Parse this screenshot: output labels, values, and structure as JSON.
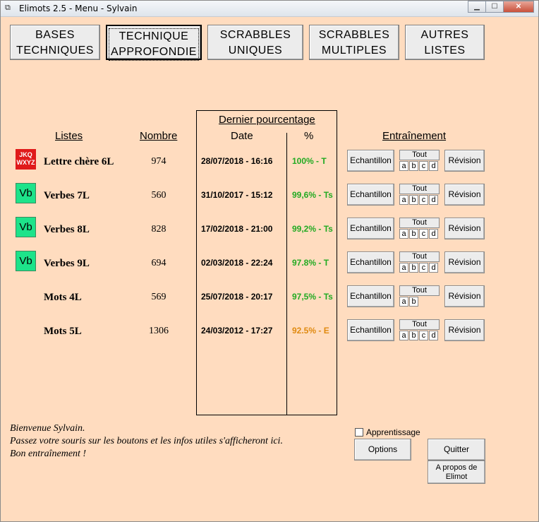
{
  "window": {
    "title": "Elimots 2.5 - Menu - Sylvain",
    "min": "▁",
    "max": "☐",
    "close": "✕"
  },
  "nav": [
    {
      "line1": "BASES",
      "line2": "TECHNIQUES"
    },
    {
      "line1": "TECHNIQUE",
      "line2": "APPROFONDIE"
    },
    {
      "line1": "SCRABBLES",
      "line2": "UNIQUES"
    },
    {
      "line1": "SCRABBLES",
      "line2": "MULTIPLES"
    },
    {
      "line1": "AUTRES",
      "line2": "LISTES"
    }
  ],
  "headers": {
    "listes": "Listes",
    "nombre": "Nombre",
    "dernier": "Dernier pourcentage",
    "date": "Date",
    "pct": "%",
    "entrainement": "Entraînement"
  },
  "rows": [
    {
      "icon": "JKQ\nWXYZ",
      "icon_type": "jkq",
      "name": "Lettre chère 6L",
      "count": "974",
      "date": "28/07/2018 - 16:16",
      "pct": "100% - T",
      "pct_color": "#22aa22",
      "letters": [
        "a",
        "b",
        "c",
        "d"
      ]
    },
    {
      "icon": "Vb",
      "icon_type": "vb",
      "name": "Verbes 7L",
      "count": "560",
      "date": "31/10/2017 - 15:12",
      "pct": "99,6% - Ts",
      "pct_color": "#22aa22",
      "letters": [
        "a",
        "b",
        "c",
        "d"
      ]
    },
    {
      "icon": "Vb",
      "icon_type": "vb",
      "name": "Verbes 8L",
      "count": "828",
      "date": "17/02/2018 - 21:00",
      "pct": "99,2% - Ts",
      "pct_color": "#22aa22",
      "letters": [
        "a",
        "b",
        "c",
        "d"
      ]
    },
    {
      "icon": "Vb",
      "icon_type": "vb",
      "name": "Verbes 9L",
      "count": "694",
      "date": "02/03/2018 - 22:24",
      "pct": "97.8% - T",
      "pct_color": "#22aa22",
      "letters": [
        "a",
        "b",
        "c",
        "d"
      ]
    },
    {
      "icon": "",
      "icon_type": "none",
      "name": "Mots 4L",
      "count": "569",
      "date": "25/07/2018 - 20:17",
      "pct": "97,5% - Ts",
      "pct_color": "#22aa22",
      "letters": [
        "a",
        "b"
      ]
    },
    {
      "icon": "",
      "icon_type": "none",
      "name": "Mots 5L",
      "count": "1306",
      "date": "24/03/2012 - 17:27",
      "pct": "92.5% - E",
      "pct_color": "#e08a10",
      "letters": [
        "a",
        "b",
        "c",
        "d"
      ]
    }
  ],
  "row_buttons": {
    "echantillon": "Echantillon",
    "tout": "Tout",
    "revision": "Révision"
  },
  "message": {
    "line1": "Bienvenue Sylvain.",
    "line2": "Passez votre souris sur les boutons et les infos utiles s'afficheront ici.",
    "line3": "Bon entraînement !"
  },
  "apprentissage": {
    "label": "Apprentissage",
    "checked": false
  },
  "buttons": {
    "options": "Options",
    "quitter": "Quitter",
    "apropos": "A propos de Elimot"
  }
}
